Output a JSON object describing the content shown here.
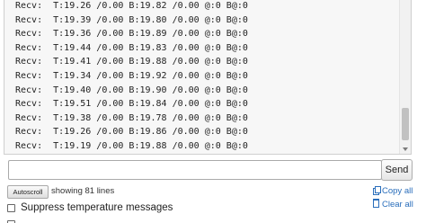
{
  "terminal": {
    "lines": [
      "Recv:  T:19.26 /0.00 B:19.82 /0.00 @:0 B@:0",
      "Recv:  T:19.39 /0.00 B:19.80 /0.00 @:0 B@:0",
      "Recv:  T:19.36 /0.00 B:19.89 /0.00 @:0 B@:0",
      "Recv:  T:19.44 /0.00 B:19.83 /0.00 @:0 B@:0",
      "Recv:  T:19.41 /0.00 B:19.88 /0.00 @:0 B@:0",
      "Recv:  T:19.34 /0.00 B:19.92 /0.00 @:0 B@:0",
      "Recv:  T:19.40 /0.00 B:19.90 /0.00 @:0 B@:0",
      "Recv:  T:19.51 /0.00 B:19.84 /0.00 @:0 B@:0",
      "Recv:  T:19.38 /0.00 B:19.78 /0.00 @:0 B@:0",
      "Recv:  T:19.26 /0.00 B:19.86 /0.00 @:0 B@:0",
      "Recv:  T:19.19 /0.00 B:19.88 /0.00 @:0 B@:0"
    ]
  },
  "command": {
    "value": "",
    "send_label": "Send"
  },
  "autoscroll": {
    "button_label": "Autoscroll",
    "status_text": "showing 81 lines"
  },
  "actions": {
    "copy_label": "Copy all",
    "clear_label": "Clear all",
    "copy_icon": "copy-icon",
    "clear_icon": "trash-icon"
  },
  "options": {
    "suppress_temperature_label": "Suppress temperature messages",
    "suppress_temperature_checked": false,
    "second_option_checked": false
  },
  "colors": {
    "link": "#2a6ebb",
    "terminal_bg": "#f7f7f7"
  }
}
